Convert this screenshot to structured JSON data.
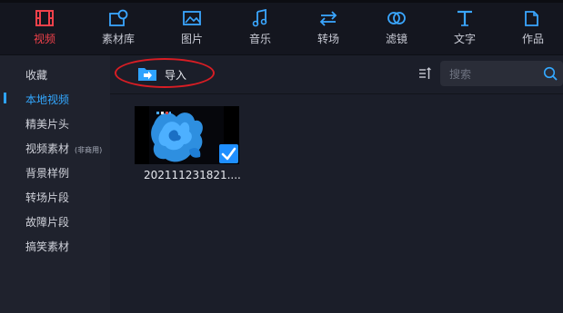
{
  "tabs": [
    {
      "label": "视频",
      "icon": "film-icon",
      "active": true
    },
    {
      "label": "素材库",
      "icon": "media-library-icon"
    },
    {
      "label": "图片",
      "icon": "image-icon"
    },
    {
      "label": "音乐",
      "icon": "music-icon"
    },
    {
      "label": "转场",
      "icon": "transition-icon"
    },
    {
      "label": "滤镜",
      "icon": "filter-icon"
    },
    {
      "label": "文字",
      "icon": "text-icon"
    },
    {
      "label": "作品",
      "icon": "folder-icon"
    }
  ],
  "sidebar": {
    "items": [
      {
        "label": "收藏"
      },
      {
        "label": "本地视频",
        "active": true
      },
      {
        "label": "精美片头"
      },
      {
        "label": "视频素材",
        "sub": "(非商用)"
      },
      {
        "label": "背景样例"
      },
      {
        "label": "转场片段"
      },
      {
        "label": "故障片段"
      },
      {
        "label": "搞笑素材"
      }
    ]
  },
  "toolbar": {
    "import_label": "导入",
    "search_placeholder": "搜索"
  },
  "files": [
    {
      "name": "202111231821....",
      "selected": true
    }
  ],
  "colors": {
    "accent_active_tab": "#f0414a",
    "accent_blue": "#2ea3ff",
    "annotation_circle": "#d81d24"
  }
}
